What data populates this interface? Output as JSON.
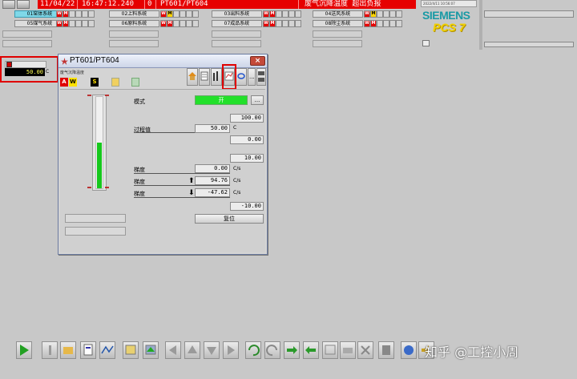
{
  "header": {
    "alarm_date": "11/04/22",
    "alarm_time": "16:47:12.240",
    "alarm_zero": "0",
    "alarm_tag": "PT601/PT604",
    "alarm_text": "废气沉降温度  超出负报",
    "clock": "2022/4/11 10:56:07"
  },
  "areas": {
    "row1": [
      "01窑体系统",
      "02上料系统",
      "03出料系统",
      "04送风系统"
    ],
    "row2": [
      "05煤气系统",
      "06原料系统",
      "07成品系统",
      "08除尘系统"
    ],
    "active": "01窑体系统"
  },
  "branding": {
    "brand": "SIEMENS",
    "product": "PCS 7"
  },
  "block_icon": {
    "value": "50.00",
    "unit": "C"
  },
  "faceplate": {
    "title": "PT601/PT604",
    "close_label": "×",
    "subtitle": "废气沉降温度",
    "status_labels": [
      "A",
      "W",
      "S"
    ],
    "mode_label": "模式",
    "mode_value": "开",
    "mode_button": "...",
    "hi_range": "100.00",
    "pv_label": "过程值",
    "pv_value": "50.00",
    "pv_unit": "C",
    "lo_range": "0.00",
    "grad_limit": "10.00",
    "grad_label": "梯度",
    "grad_value": "0.00",
    "grad_pos_label": "梯度",
    "grad_pos_value": "94.76",
    "grad_neg_label": "梯度",
    "grad_neg_value": "-47.62",
    "grad_unit": "C/s",
    "grad_low_limit": "-10.00",
    "reset_label": "复位",
    "bar_fraction": 0.5
  },
  "watermark": {
    "text": "知乎 @工控小周"
  }
}
